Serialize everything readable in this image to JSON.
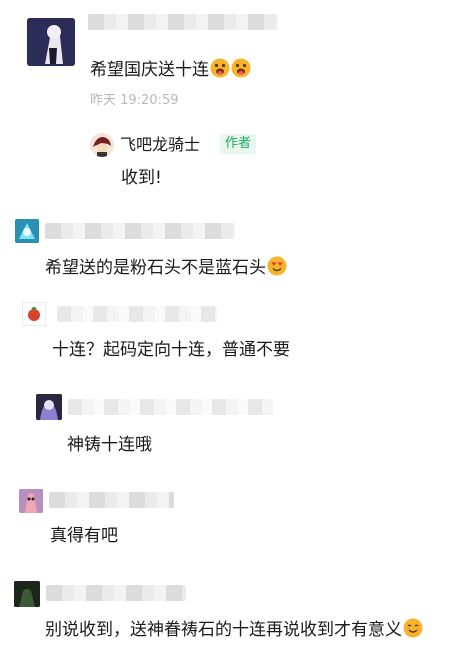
{
  "thread": {
    "post": {
      "text": "希望国庆送十连",
      "emojis": [
        "tongue-face-emoji",
        "tongue-face-emoji"
      ],
      "time": "昨天 19:20:59"
    },
    "reply": {
      "author": "飞吧龙骑士",
      "badge": "作者",
      "text": "收到!"
    },
    "comments": [
      {
        "text": "希望送的是粉石头不是蓝石头",
        "emoji": "heart-eyes-emoji"
      },
      {
        "text": "十连？起码定向十连，普通不要"
      },
      {
        "text": "神铸十连哦"
      },
      {
        "text": "真得有吧"
      },
      {
        "text": "别说收到，送神眷祷石的十连再说收到才有意义",
        "emoji": "smile-emoji"
      }
    ]
  },
  "colors": {
    "author_badge": "#1aad5f",
    "time": "#b8b8b8",
    "emoji": "#f4b400"
  }
}
